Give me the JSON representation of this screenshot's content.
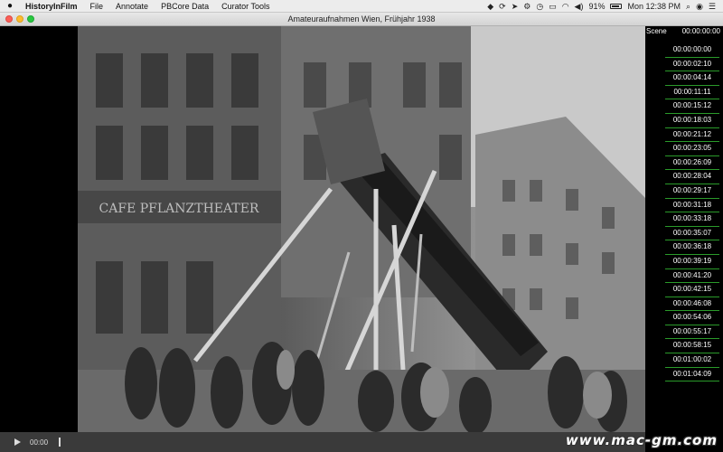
{
  "menubar": {
    "app_name": "HistoryInFilm",
    "items": [
      "File",
      "Annotate",
      "PBCore Data",
      "Curator Tools"
    ],
    "battery": "91%",
    "clock": "Mon 12:38 PM"
  },
  "window": {
    "title": "Amateuraufnahmen Wien, Frühjahr 1938"
  },
  "scene_panel": {
    "header_label": "Scene",
    "header_time": "00:00:00:00",
    "scenes": [
      "00:00:00:00",
      "00:00:02:10",
      "00:00:04:14",
      "00:00:11:11",
      "00:00:15:12",
      "00:00:18:03",
      "00:00:21:12",
      "00:00:23:05",
      "00:00:26:09",
      "00:00:28:04",
      "00:00:29:17",
      "00:00:31:18",
      "00:00:33:18",
      "00:00:35:07",
      "00:00:36:18",
      "00:00:39:19",
      "00:00:41:20",
      "00:00:42:15",
      "00:00:46:08",
      "00:00:54:06",
      "00:00:55:17",
      "00:00:58:15",
      "00:01:00:02",
      "00:01:04:09"
    ]
  },
  "player": {
    "current_time": "00:00"
  },
  "video": {
    "sign_text": "CAFE PFLANZTHEATER"
  },
  "watermark": "www.mac-gm.com"
}
